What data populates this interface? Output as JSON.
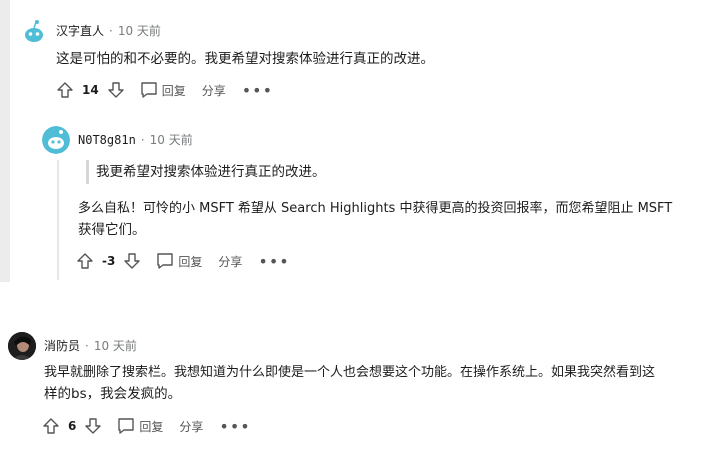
{
  "comments": [
    {
      "username": "汉字直人",
      "time": "10 天前",
      "text": "这是可怕的和不必要的。我更希望对搜索体验进行真正的改进。",
      "votes": "14",
      "reply_label": "回复",
      "share_label": "分享",
      "more_label": "•••"
    },
    {
      "username": "N0T8g81n",
      "time": "10 天前",
      "quote": "我更希望对搜索体验进行真正的改进。",
      "text_line1": "多么自私！可怜的小 MSFT 希望从 Search Highlights 中获得更高的投资回报率，而您希望阻止 MSFT",
      "text_line2": "获得它们。",
      "votes": "-3",
      "reply_label": "回复",
      "share_label": "分享",
      "more_label": "•••"
    },
    {
      "username": "消防员",
      "time": "10 天前",
      "text_line1": "我早就删除了搜索栏。我想知道为什么即使是一个人也会想要这个功能。在操作系统上。如果我突然看到这",
      "text_line2": "样的bs，我会发疯的。",
      "votes": "6",
      "reply_label": "回复",
      "share_label": "分享",
      "more_label": "•••"
    }
  ],
  "separator": "·",
  "colors": {
    "snoo_blue": "#4fbdd6",
    "line": "#e6e6e6",
    "muted": "#787c7e"
  },
  "icons": [
    "snoo-avatar-icon",
    "upvote-icon",
    "downvote-icon",
    "comment-icon"
  ]
}
